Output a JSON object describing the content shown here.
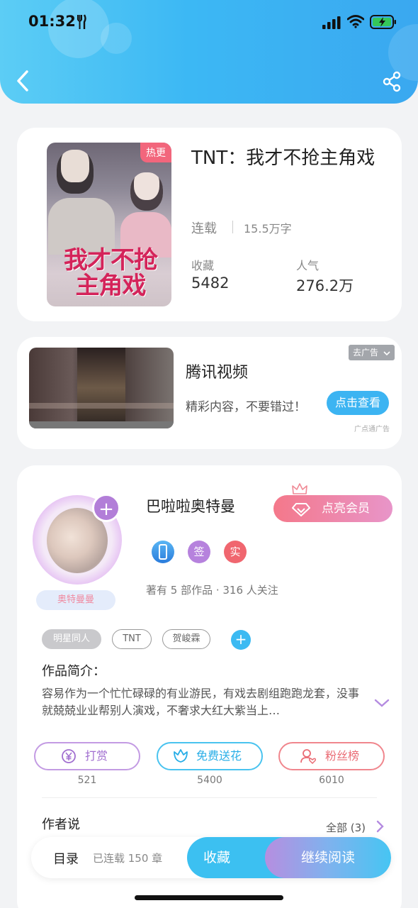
{
  "status_bar": {
    "time": "01:32"
  },
  "book": {
    "title": "TNT：我才不抢主角戏",
    "hot_badge": "热更",
    "cover_title": "我才不抢主角戏",
    "status": "连载",
    "words": "15.5万字",
    "favorites_label": "收藏",
    "favorites_value": "5482",
    "popularity_label": "人气",
    "popularity_value": "276.2万"
  },
  "ad": {
    "title": "腾讯视频",
    "description": "精彩内容，不要错过！",
    "button": "点击查看",
    "close": "去广告",
    "source": "广点通广告"
  },
  "author": {
    "name": "巴啦啦奥特曼",
    "avatar_name": "奥特曼曼",
    "vip_button": "点亮会员",
    "badges": [
      "签",
      "实"
    ],
    "meta": "著有 5 部作品 · 316 人关注",
    "tags": [
      "明星同人",
      "TNT",
      "贺峻霖"
    ],
    "intro_label": "作品简介：",
    "intro": "容易作为一个忙忙碌碌的有业游民，有戏去剧组跑跑龙套，没事就兢兢业业帮别人演戏，不奢求大红大紫当上…",
    "actions": [
      {
        "label": "打赏",
        "count": "521"
      },
      {
        "label": "免费送花",
        "count": "5400"
      },
      {
        "label": "粉丝榜",
        "count": "6010"
      }
    ],
    "author_says": "作者说",
    "all_link": "全部 (3)"
  },
  "bottom_bar": {
    "toc": "目录",
    "chapters": "已连载 150 章",
    "collect": "收藏",
    "continue": "继续阅读"
  },
  "colors": {
    "header": "#3cb8f4",
    "accent": "#3cc0f1",
    "hot": "#f2667c",
    "vip": "#f4788a"
  }
}
